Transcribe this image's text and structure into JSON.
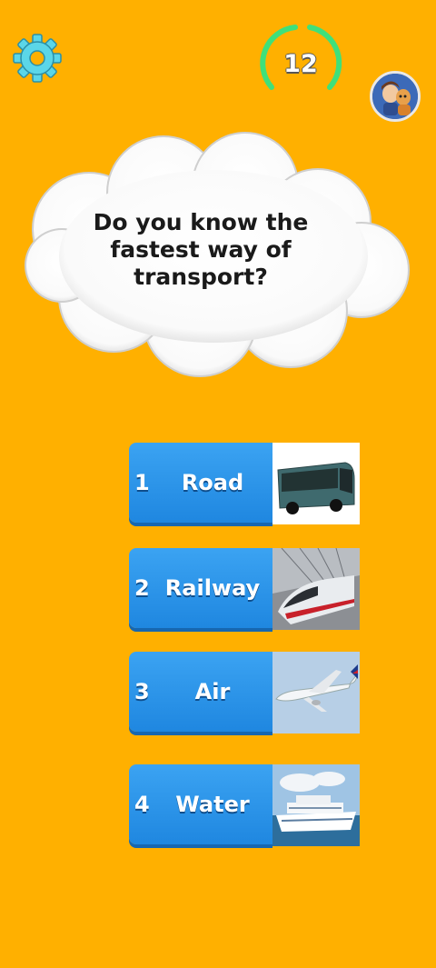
{
  "header": {
    "settings_icon": "gear-icon",
    "timer_value": "12",
    "timer_color": "#3FE07A",
    "avatar_icon": "character-avatar"
  },
  "question": {
    "line1": "Do you know the",
    "line2": "fastest way of",
    "line3": "transport?"
  },
  "options": [
    {
      "number": "1",
      "label": "Road",
      "image": "bus-image"
    },
    {
      "number": "2",
      "label": "Railway",
      "image": "train-image"
    },
    {
      "number": "3",
      "label": "Air",
      "image": "airplane-image"
    },
    {
      "number": "4",
      "label": "Water",
      "image": "ship-image"
    }
  ]
}
